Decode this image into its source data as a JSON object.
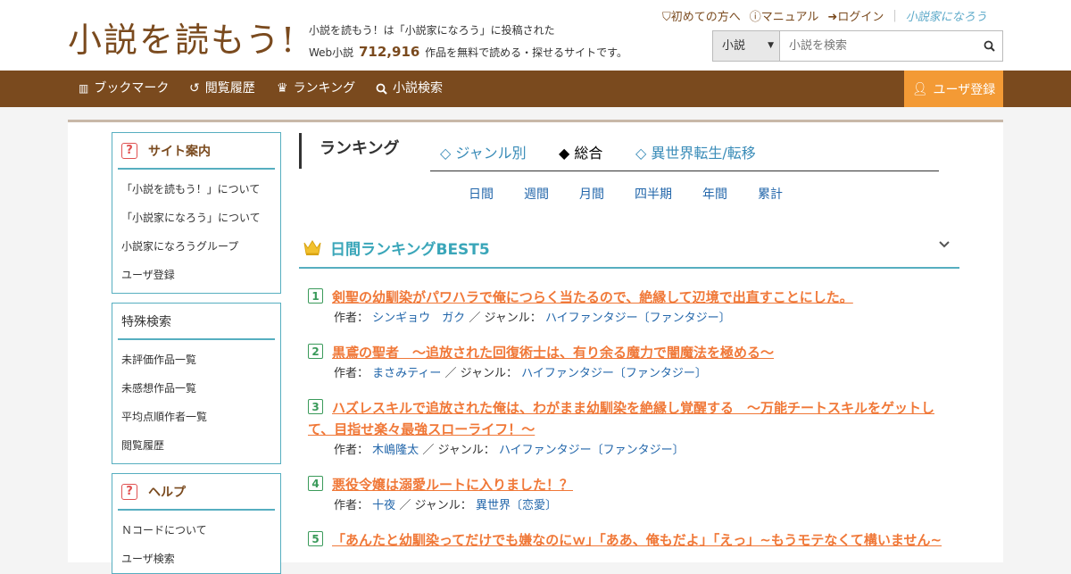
{
  "header": {
    "logo": "小説を読もう!",
    "tagline_line1": "小説を読もう！は「小説家になろう」に投稿された",
    "tagline_prefix": "Web小説",
    "work_count": "712,916",
    "tagline_suffix": "作品を無料で読める・探せるサイトです。",
    "links": {
      "first_time": "初めての方へ",
      "manual": "マニュアル",
      "login": "ログイン",
      "brand": "小説家になろう"
    },
    "search": {
      "category": "小説",
      "placeholder": "小説を検索"
    }
  },
  "nav": {
    "bookmark": "ブックマーク",
    "history": "閲覧履歴",
    "ranking": "ランキング",
    "search": "小説検索",
    "register": "ユーザ登録"
  },
  "sidebar": {
    "site_guide": {
      "title": "サイト案内",
      "items": [
        "「小説を読もう！」について",
        "「小説家になろう」について",
        "小説家になろうグループ",
        "ユーザ登録"
      ]
    },
    "special_search": {
      "title": "特殊検索",
      "items": [
        "未評価作品一覧",
        "未感想作品一覧",
        "平均点順作者一覧",
        "閲覧履歴"
      ]
    },
    "help": {
      "title": "ヘルプ",
      "items": [
        "Ｎコードについて",
        "ユーザ検索"
      ]
    }
  },
  "ranking": {
    "title": "ランキング",
    "tabs": {
      "genre": "◇ ジャンル別",
      "overall": "◆ 総合",
      "isekai": "◇ 異世界転生/転移"
    },
    "periods": [
      "日間",
      "週間",
      "月間",
      "四半期",
      "年間",
      "累計"
    ],
    "best_title": "日間ランキングBEST5",
    "author_label": "作者：",
    "genre_label": "／ ジャンル：",
    "items": [
      {
        "num": "1",
        "title": "剣聖の幼馴染がパワハラで俺につらく当たるので、絶縁して辺境で出直すことにした。",
        "author": "シンギョウ　ガク",
        "genre": "ハイファンタジー〔ファンタジー〕"
      },
      {
        "num": "2",
        "title": "黒鳶の聖者　～追放された回復術士は、有り余る魔力で闇魔法を極める～",
        "author": "まさみティー",
        "genre": "ハイファンタジー〔ファンタジー〕"
      },
      {
        "num": "3",
        "title": "ハズレスキルで追放された俺は、わがまま幼馴染を絶縁し覚醒する　～万能チートスキルをゲットして、目指せ楽々最強スローライフ！～",
        "author": "木嶋隆太",
        "genre": "ハイファンタジー〔ファンタジー〕"
      },
      {
        "num": "4",
        "title": "悪役令嬢は溺愛ルートに入りました！？",
        "author": "十夜",
        "genre": "異世界〔恋愛〕"
      },
      {
        "num": "5",
        "title": "「あんたと幼馴染ってだけでも嫌なのにｗ」「ああ、俺もだよ」「えっ」~もうモテなくて構いません~",
        "author": "",
        "genre": ""
      }
    ]
  },
  "colors": {
    "brand_brown": "#7a4a1e",
    "accent_orange": "#f39a35",
    "teal": "#56aec0",
    "link_blue": "#2266aa",
    "title_orange": "#f07838"
  }
}
